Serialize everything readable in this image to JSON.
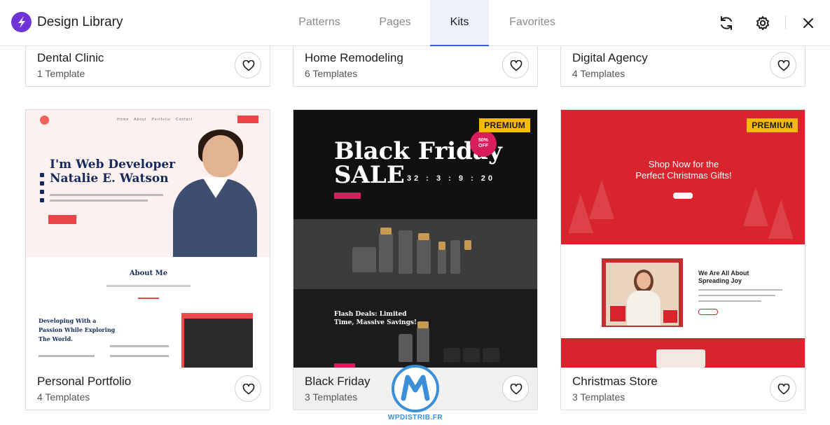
{
  "app": {
    "title": "Design Library"
  },
  "tabs": [
    {
      "label": "Patterns",
      "active": false
    },
    {
      "label": "Pages",
      "active": false
    },
    {
      "label": "Kits",
      "active": true
    },
    {
      "label": "Favorites",
      "active": false
    }
  ],
  "header_icons": [
    "refresh-icon",
    "gear-icon",
    "close-icon"
  ],
  "kits_top": [
    {
      "name": "Dental Clinic",
      "count": "1 Template"
    },
    {
      "name": "Home Remodeling",
      "count": "6 Templates"
    },
    {
      "name": "Digital Agency",
      "count": "4 Templates"
    }
  ],
  "kits": [
    {
      "name": "Personal Portfolio",
      "count": "4 Templates",
      "premium": false
    },
    {
      "name": "Black Friday",
      "count": "3 Templates",
      "premium": true
    },
    {
      "name": "Christmas Store",
      "count": "3 Templates",
      "premium": true
    }
  ],
  "badge_label": "PREMIUM",
  "previews": {
    "portfolio": {
      "heading_1": "I'm Web Developer",
      "heading_2": "Natalie E. Watson",
      "section": "About Me",
      "subheading_1": "Developing With a",
      "subheading_2": "Passion While Exploring",
      "subheading_3": "The World."
    },
    "black_friday": {
      "heading_1": "Black Friday",
      "heading_2": "SALE",
      "discount_1": "50%",
      "discount_2": "OFF",
      "timer": "32 : 3 : 9 : 20",
      "subheading_1": "Flash Deals: Limited",
      "subheading_2": "Time, Massive Savings!"
    },
    "christmas": {
      "heading_1": "Shop Now for the",
      "heading_2": "Perfect Christmas Gifts!",
      "subheading_1": "We Are All About",
      "subheading_2": "Spreading Joy"
    }
  },
  "watermark": {
    "text": "WPDISTRIB.FR"
  },
  "colors": {
    "accent": "#3b5bdb",
    "logo": "#6e34d8",
    "premium": "#f5b90a",
    "christmas_red": "#d8242c",
    "portfolio_red": "#e94545"
  }
}
